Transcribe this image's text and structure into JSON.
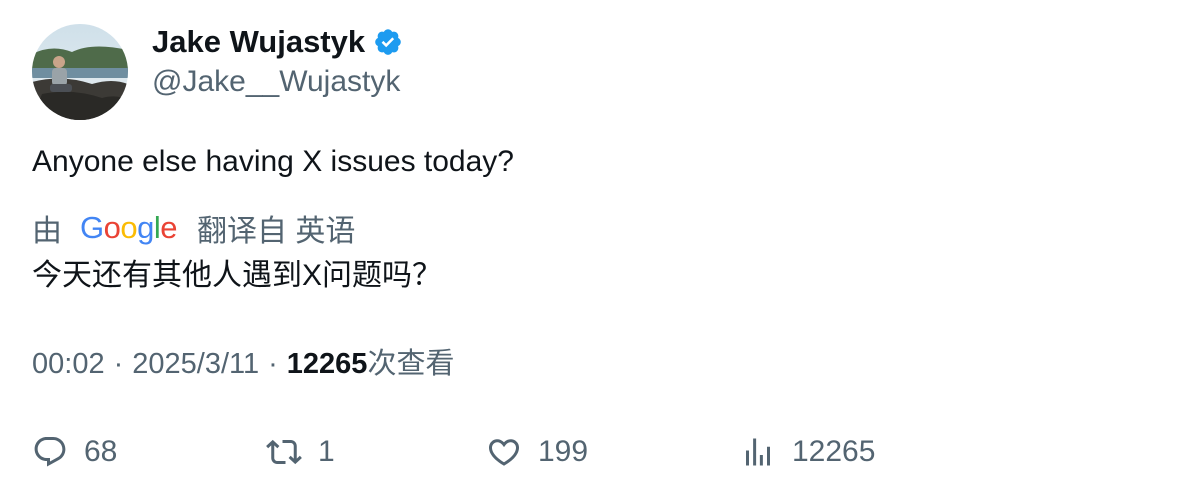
{
  "author": {
    "display_name": "Jake Wujastyk",
    "handle": "@Jake__Wujastyk",
    "verified": true
  },
  "tweet": {
    "text": "Anyone else having X issues today?"
  },
  "translation": {
    "by_label": "由",
    "provider": "Google",
    "translated_from": "翻译自 英语",
    "text": "今天还有其他人遇到X问题吗？"
  },
  "meta": {
    "time": "00:02",
    "separator": "·",
    "date": "2025/3/11",
    "views_count": "12265",
    "views_label": "次查看"
  },
  "actions": {
    "replies": "68",
    "retweets": "1",
    "likes": "199",
    "views": "12265"
  },
  "colors": {
    "text": "#0f1419",
    "secondary": "#536471",
    "verified": "#1d9bf0"
  }
}
